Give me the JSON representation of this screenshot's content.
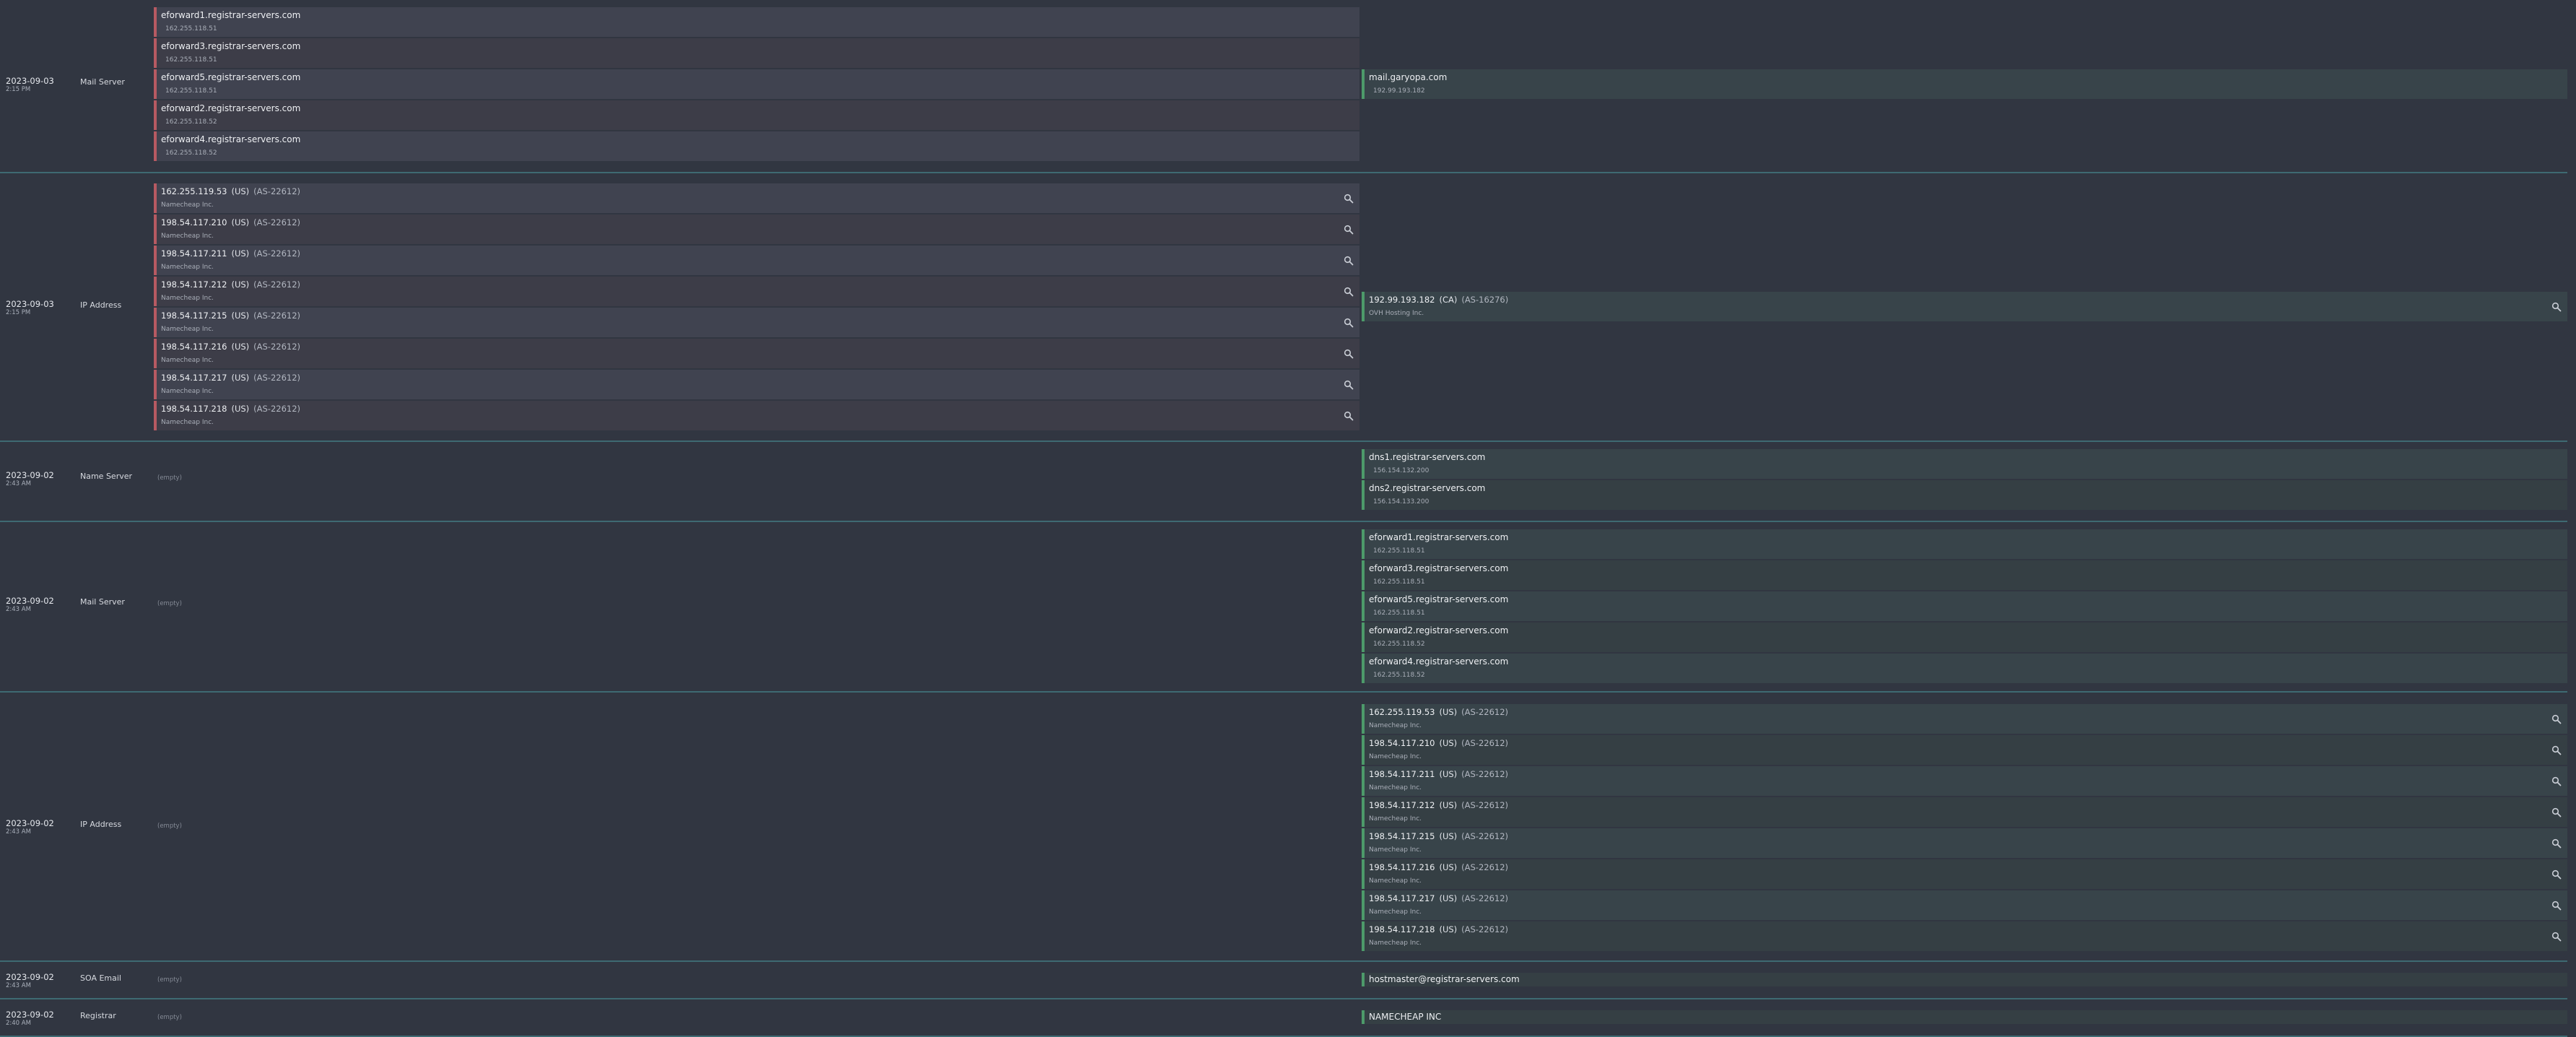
{
  "rows": [
    {
      "date": "2023-09-03",
      "time": "2:15 PM",
      "type": "Mail Server",
      "old_records": [
        {
          "host": "eforward1.registrar-servers.com",
          "ip": "162.255.118.51"
        },
        {
          "host": "eforward3.registrar-servers.com",
          "ip": "162.255.118.51"
        },
        {
          "host": "eforward5.registrar-servers.com",
          "ip": "162.255.118.51"
        },
        {
          "host": "eforward2.registrar-servers.com",
          "ip": "162.255.118.52"
        },
        {
          "host": "eforward4.registrar-servers.com",
          "ip": "162.255.118.52"
        }
      ],
      "new_records": [
        {
          "host": "mail.garyopa.com",
          "ip": "192.99.193.182"
        }
      ]
    },
    {
      "date": "2023-09-03",
      "time": "2:15 PM",
      "type": "IP Address",
      "old_ips": [
        {
          "ip": "162.255.119.53",
          "country": "(US)",
          "asn": "(AS-22612)",
          "org": "Namecheap Inc."
        },
        {
          "ip": "198.54.117.210",
          "country": "(US)",
          "asn": "(AS-22612)",
          "org": "Namecheap Inc."
        },
        {
          "ip": "198.54.117.211",
          "country": "(US)",
          "asn": "(AS-22612)",
          "org": "Namecheap Inc."
        },
        {
          "ip": "198.54.117.212",
          "country": "(US)",
          "asn": "(AS-22612)",
          "org": "Namecheap Inc."
        },
        {
          "ip": "198.54.117.215",
          "country": "(US)",
          "asn": "(AS-22612)",
          "org": "Namecheap Inc."
        },
        {
          "ip": "198.54.117.216",
          "country": "(US)",
          "asn": "(AS-22612)",
          "org": "Namecheap Inc."
        },
        {
          "ip": "198.54.117.217",
          "country": "(US)",
          "asn": "(AS-22612)",
          "org": "Namecheap Inc."
        },
        {
          "ip": "198.54.117.218",
          "country": "(US)",
          "asn": "(AS-22612)",
          "org": "Namecheap Inc."
        }
      ],
      "new_ips": [
        {
          "ip": "192.99.193.182",
          "country": "(CA)",
          "asn": "(AS-16276)",
          "org": "OVH Hosting Inc."
        }
      ]
    },
    {
      "date": "2023-09-02",
      "time": "2:43 AM",
      "type": "Name Server",
      "empty": "(empty)",
      "new_records": [
        {
          "host": "dns1.registrar-servers.com",
          "ip": "156.154.132.200"
        },
        {
          "host": "dns2.registrar-servers.com",
          "ip": "156.154.133.200"
        }
      ]
    },
    {
      "date": "2023-09-02",
      "time": "2:43 AM",
      "type": "Mail Server",
      "empty": "(empty)",
      "new_records": [
        {
          "host": "eforward1.registrar-servers.com",
          "ip": "162.255.118.51"
        },
        {
          "host": "eforward3.registrar-servers.com",
          "ip": "162.255.118.51"
        },
        {
          "host": "eforward5.registrar-servers.com",
          "ip": "162.255.118.51"
        },
        {
          "host": "eforward2.registrar-servers.com",
          "ip": "162.255.118.52"
        },
        {
          "host": "eforward4.registrar-servers.com",
          "ip": "162.255.118.52"
        }
      ]
    },
    {
      "date": "2023-09-02",
      "time": "2:43 AM",
      "type": "IP Address",
      "empty": "(empty)",
      "new_ips": [
        {
          "ip": "162.255.119.53",
          "country": "(US)",
          "asn": "(AS-22612)",
          "org": "Namecheap Inc."
        },
        {
          "ip": "198.54.117.210",
          "country": "(US)",
          "asn": "(AS-22612)",
          "org": "Namecheap Inc."
        },
        {
          "ip": "198.54.117.211",
          "country": "(US)",
          "asn": "(AS-22612)",
          "org": "Namecheap Inc."
        },
        {
          "ip": "198.54.117.212",
          "country": "(US)",
          "asn": "(AS-22612)",
          "org": "Namecheap Inc."
        },
        {
          "ip": "198.54.117.215",
          "country": "(US)",
          "asn": "(AS-22612)",
          "org": "Namecheap Inc."
        },
        {
          "ip": "198.54.117.216",
          "country": "(US)",
          "asn": "(AS-22612)",
          "org": "Namecheap Inc."
        },
        {
          "ip": "198.54.117.217",
          "country": "(US)",
          "asn": "(AS-22612)",
          "org": "Namecheap Inc."
        },
        {
          "ip": "198.54.117.218",
          "country": "(US)",
          "asn": "(AS-22612)",
          "org": "Namecheap Inc."
        }
      ]
    },
    {
      "date": "2023-09-02",
      "time": "2:43 AM",
      "type": "SOA Email",
      "empty": "(empty)",
      "new_value": "hostmaster@registrar-servers.com"
    },
    {
      "date": "2023-09-02",
      "time": "2:40 AM",
      "type": "Registrar",
      "empty": "(empty)",
      "new_value": "NAMECHEAP INC"
    }
  ],
  "colors": {
    "removed": "#b75a62",
    "added": "#4d9a6a",
    "divider": "#3e6a72"
  },
  "icons": {
    "lookup": "magnifier-icon"
  }
}
